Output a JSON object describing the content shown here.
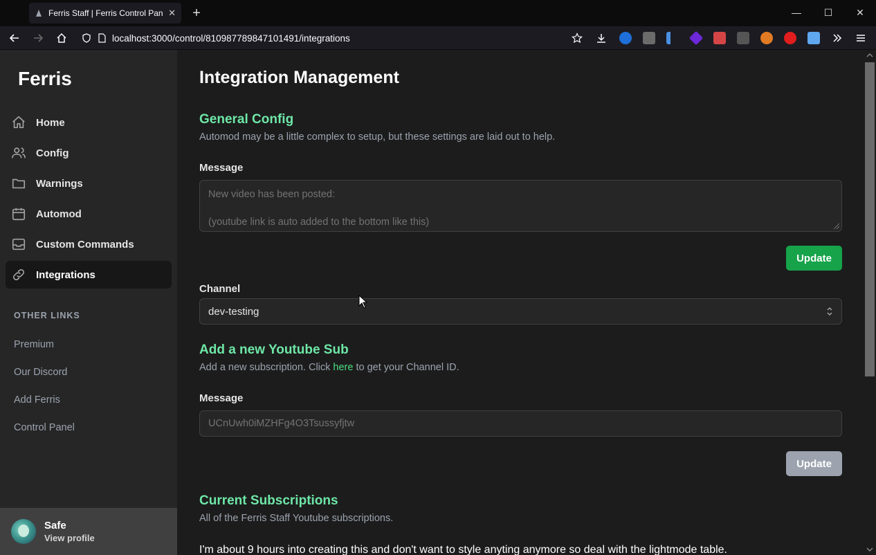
{
  "browser": {
    "tab_title": "Ferris Staff | Ferris Control Panel",
    "url": "localhost:3000/control/810987789847101491/integrations"
  },
  "sidebar": {
    "brand": "Ferris",
    "items": [
      {
        "label": "Home",
        "icon": "home-icon"
      },
      {
        "label": "Config",
        "icon": "users-icon"
      },
      {
        "label": "Warnings",
        "icon": "folder-icon"
      },
      {
        "label": "Automod",
        "icon": "calendar-icon"
      },
      {
        "label": "Custom Commands",
        "icon": "inbox-icon"
      },
      {
        "label": "Integrations",
        "icon": "link-icon",
        "active": true
      }
    ],
    "other_links_heading": "OTHER LINKS",
    "other_links": [
      "Premium",
      "Our Discord",
      "Add Ferris",
      "Control Panel"
    ],
    "profile": {
      "name": "Safe",
      "sub": "View profile"
    }
  },
  "main": {
    "title": "Integration Management",
    "general": {
      "heading": "General Config",
      "description": "Automod may be a little complex to setup, but these settings are laid out to help.",
      "message_label": "Message",
      "message_placeholder_line1": "New video has been posted:",
      "message_placeholder_line2": "(youtube link is auto added to the bottom like this)",
      "update_label": "Update",
      "channel_label": "Channel",
      "channel_value": "dev-testing"
    },
    "add_sub": {
      "heading": "Add a new Youtube Sub",
      "desc_before": "Add a new subscription. Click ",
      "desc_link": "here",
      "desc_after": " to get your Channel ID.",
      "message_label": "Message",
      "input_placeholder": "UCnUwh0iMZHFg4O3Tsussyfjtw",
      "update_label": "Update"
    },
    "current": {
      "heading": "Current Subscriptions",
      "description": "All of the Ferris Staff Youtube subscriptions.",
      "note": "I'm about 9 hours into creating this and don't want to style anyting anymore so deal with the lightmode table."
    }
  }
}
